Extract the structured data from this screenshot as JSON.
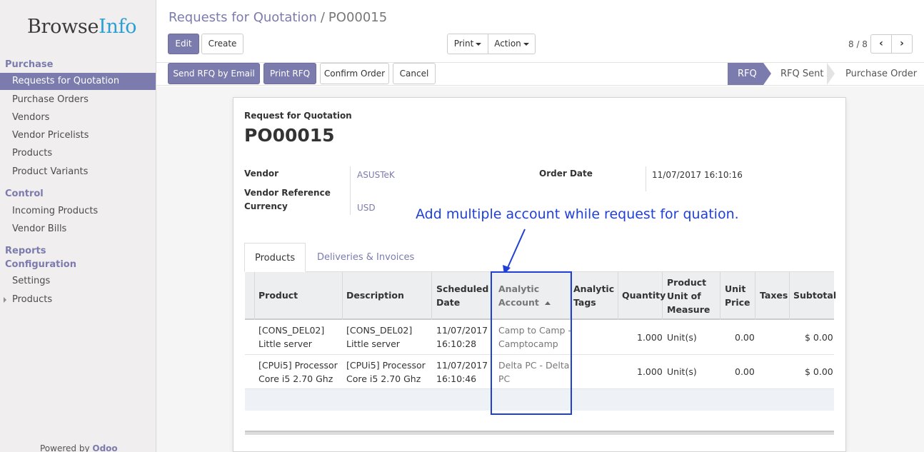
{
  "brand": {
    "name_part1": "Browse",
    "name_part2": "Info"
  },
  "sidebar": {
    "sections": [
      {
        "label": "Purchase"
      },
      {
        "label": "Control"
      },
      {
        "label": "Reports"
      },
      {
        "label": "Configuration"
      }
    ],
    "items": [
      {
        "label": "Requests for Quotation"
      },
      {
        "label": "Purchase Orders"
      },
      {
        "label": "Vendors"
      },
      {
        "label": "Vendor Pricelists"
      },
      {
        "label": "Products"
      },
      {
        "label": "Product Variants"
      },
      {
        "label": "Incoming Products"
      },
      {
        "label": "Vendor Bills"
      },
      {
        "label": "Settings"
      },
      {
        "label": "Products"
      }
    ],
    "powered_by": "Powered by",
    "powered_brand": "Odoo"
  },
  "breadcrumb": {
    "parent": "Requests for Quotation",
    "separator": "/",
    "current": "PO00015"
  },
  "toolbar": {
    "edit": "Edit",
    "create": "Create",
    "print": "Print",
    "action": "Action",
    "pager": "8 / 8"
  },
  "header_buttons": {
    "send_rfq": "Send RFQ by Email",
    "print_rfq": "Print RFQ",
    "confirm": "Confirm Order",
    "cancel": "Cancel"
  },
  "stages": [
    "RFQ",
    "RFQ Sent",
    "Purchase Order"
  ],
  "form": {
    "doc_type": "Request for Quotation",
    "doc_name": "PO00015",
    "vendor_label": "Vendor",
    "vendor_value": "ASUSTeK",
    "vendor_ref_label": "Vendor Reference",
    "currency_label": "Currency",
    "currency_value": "USD",
    "order_date_label": "Order Date",
    "order_date_value": "11/07/2017 16:10:16"
  },
  "annotation": "Add multiple  account while request for quation.",
  "tabs": [
    "Products",
    "Deliveries & Invoices"
  ],
  "table": {
    "headers": {
      "product": "Product",
      "description": "Description",
      "scheduled_1": "Scheduled",
      "scheduled_2": "Date",
      "analytic_1": "Analytic",
      "analytic_2": "Account",
      "tags_1": "Analytic",
      "tags_2": "Tags",
      "quantity": "Quantity",
      "uom_1": "Product",
      "uom_2": "Unit of",
      "uom_3": "Measure",
      "price_1": "Unit",
      "price_2": "Price",
      "taxes": "Taxes",
      "subtotal": "Subtotal"
    },
    "rows": [
      {
        "product_1": "[CONS_DEL02]",
        "product_2": "Little server",
        "desc_1": "[CONS_DEL02]",
        "desc_2": "Little server",
        "date_1": "11/07/2017",
        "date_2": "16:10:28",
        "account_1": "Camp to Camp -",
        "account_2": "Camptocamp",
        "quantity": "1.000",
        "uom": "Unit(s)",
        "price": "0.00",
        "subtotal": "$ 0.00"
      },
      {
        "product_1": "[CPUi5] Processor",
        "product_2": "Core i5 2.70 Ghz",
        "desc_1": "[CPUi5] Processor",
        "desc_2": "Core i5 2.70 Ghz",
        "date_1": "11/07/2017",
        "date_2": "16:10:46",
        "account_1": "Delta PC - Delta",
        "account_2": "PC",
        "quantity": "1.000",
        "uom": "Unit(s)",
        "price": "0.00",
        "subtotal": "$ 0.00"
      }
    ]
  },
  "colors": {
    "brand": "#7c7bad",
    "annotation": "#1f3fd6",
    "logo_accent": "#2c9fd6"
  }
}
